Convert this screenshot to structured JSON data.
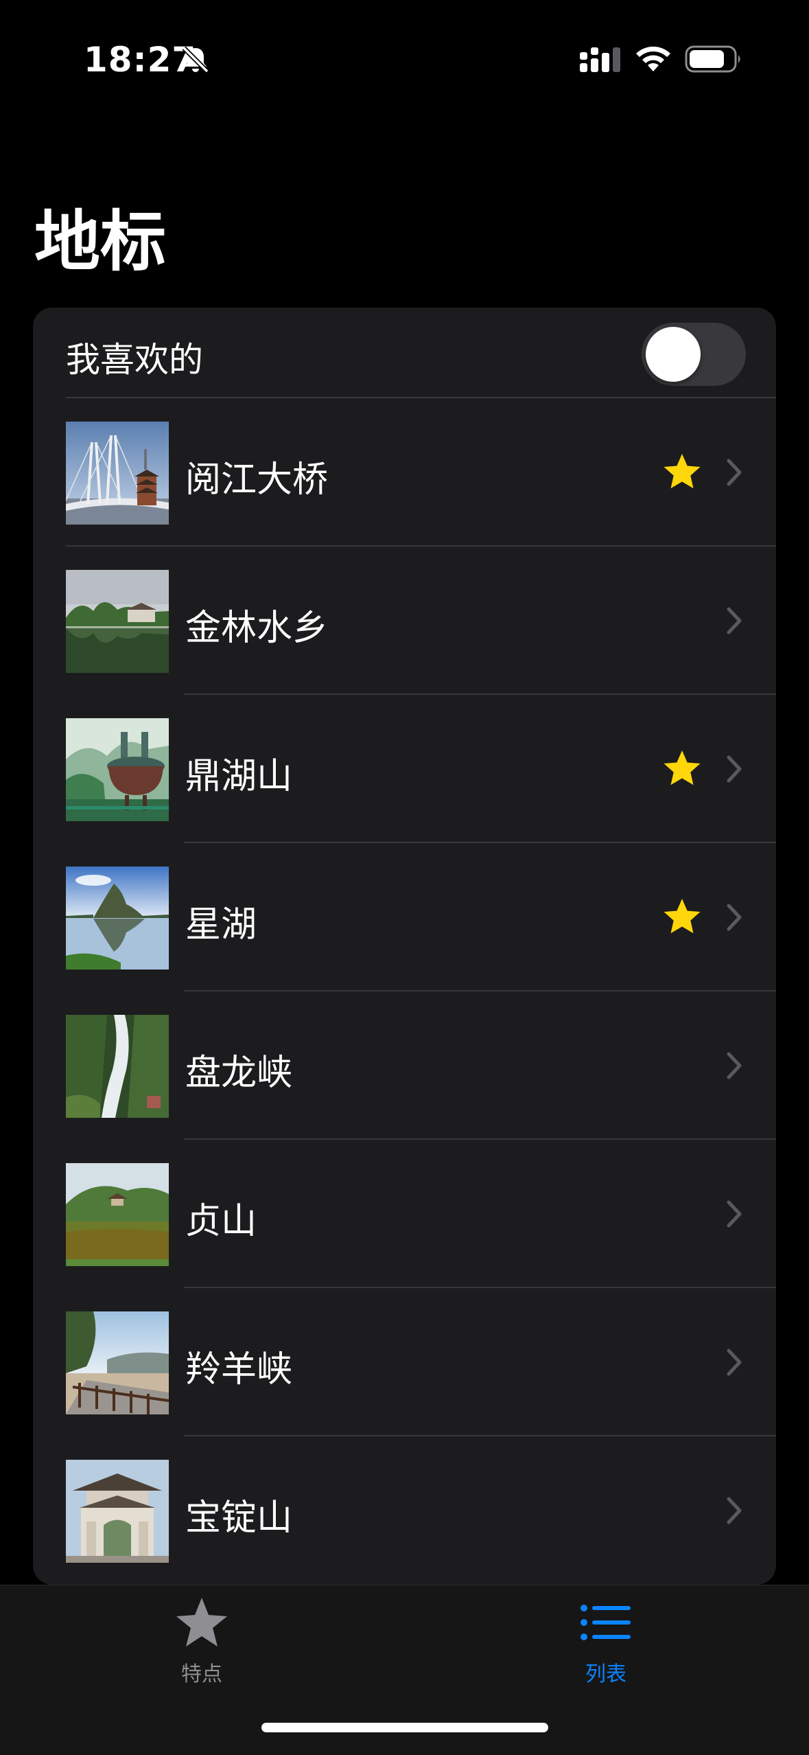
{
  "status_bar": {
    "time": "18:27",
    "icons": [
      "bell-slash-icon",
      "cellular-signal-icon",
      "wifi-icon",
      "battery-icon"
    ]
  },
  "title": "地标",
  "favorites_toggle": {
    "label": "我喜欢的",
    "on": false
  },
  "landmarks": [
    {
      "name": "阅江大桥",
      "favorite": true,
      "thumbnail": "bridge-photo"
    },
    {
      "name": "金林水乡",
      "favorite": false,
      "thumbnail": "water-village-photo"
    },
    {
      "name": "鼎湖山",
      "favorite": true,
      "thumbnail": "mountain-cauldron-photo"
    },
    {
      "name": "星湖",
      "favorite": true,
      "thumbnail": "lake-rock-photo"
    },
    {
      "name": "盘龙峡",
      "favorite": false,
      "thumbnail": "waterfall-photo"
    },
    {
      "name": "贞山",
      "favorite": false,
      "thumbnail": "pavilion-pond-photo"
    },
    {
      "name": "羚羊峡",
      "favorite": false,
      "thumbnail": "riverside-walkway-photo"
    },
    {
      "name": "宝锭山",
      "favorite": false,
      "thumbnail": "gate-arch-photo"
    }
  ],
  "tabs": [
    {
      "label": "特点",
      "icon": "star-icon",
      "selected": false
    },
    {
      "label": "列表",
      "icon": "list-icon",
      "selected": true
    }
  ],
  "colors": {
    "accent": "#0a84ff",
    "star": "#ffd60a",
    "background": "#000000",
    "card": "#1c1c1e"
  }
}
